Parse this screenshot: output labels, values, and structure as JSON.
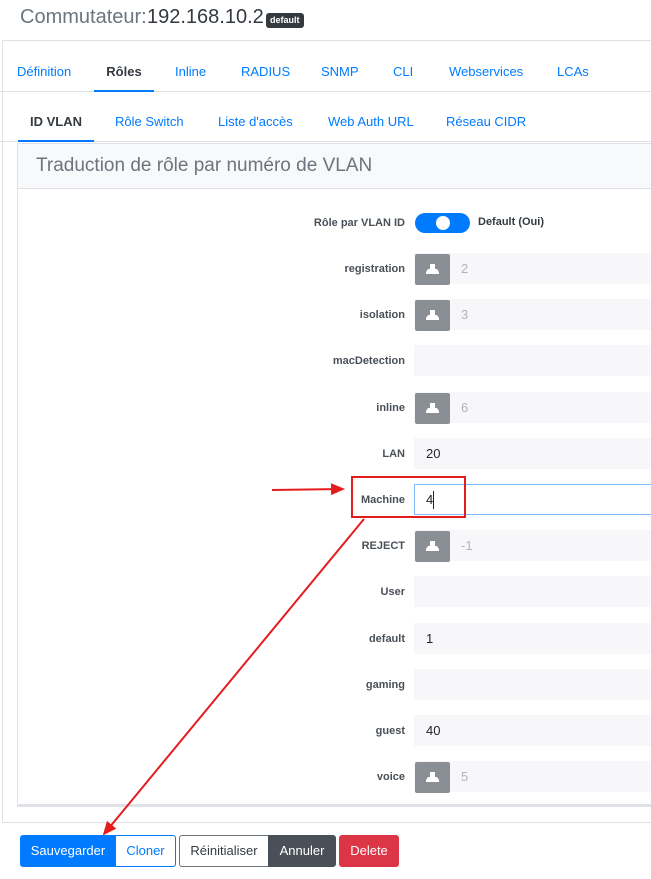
{
  "header": {
    "prefix": "Commutateur:",
    "ip": "192.168.10.2",
    "badge": "default"
  },
  "tabs_main": [
    {
      "label": "Définition"
    },
    {
      "label": "Rôles"
    },
    {
      "label": "Inline"
    },
    {
      "label": "RADIUS"
    },
    {
      "label": "SNMP"
    },
    {
      "label": "CLI"
    },
    {
      "label": "Webservices"
    },
    {
      "label": "LCAs"
    }
  ],
  "tabs_sub": [
    {
      "label": "ID VLAN"
    },
    {
      "label": "Rôle Switch"
    },
    {
      "label": "Liste d'accès"
    },
    {
      "label": "Web Auth URL"
    },
    {
      "label": "Réseau CIDR"
    }
  ],
  "card": {
    "title": "Traduction de rôle par numéro de VLAN"
  },
  "toggle": {
    "label": "Rôle par VLAN ID",
    "state": "Default (Oui)"
  },
  "rows": [
    {
      "label": "registration",
      "value": "2"
    },
    {
      "label": "isolation",
      "value": "3"
    },
    {
      "label": "macDetection",
      "value": ""
    },
    {
      "label": "inline",
      "value": "6"
    },
    {
      "label": "LAN",
      "value": "20"
    },
    {
      "label": "Machine",
      "value": "4"
    },
    {
      "label": "REJECT",
      "value": "-1"
    },
    {
      "label": "User",
      "value": ""
    },
    {
      "label": "default",
      "value": "1"
    },
    {
      "label": "gaming",
      "value": ""
    },
    {
      "label": "guest",
      "value": "40"
    },
    {
      "label": "voice",
      "value": "5"
    }
  ],
  "buttons": {
    "save": "Sauvegarder",
    "clone": "Cloner",
    "reset": "Réinitialiser",
    "cancel": "Annuler",
    "delete": "Delete"
  },
  "icons": {
    "inherit": "stamp-icon"
  },
  "colors": {
    "primary": "#007bff",
    "annotation": "#e41c1c",
    "danger": "#dc3545"
  }
}
